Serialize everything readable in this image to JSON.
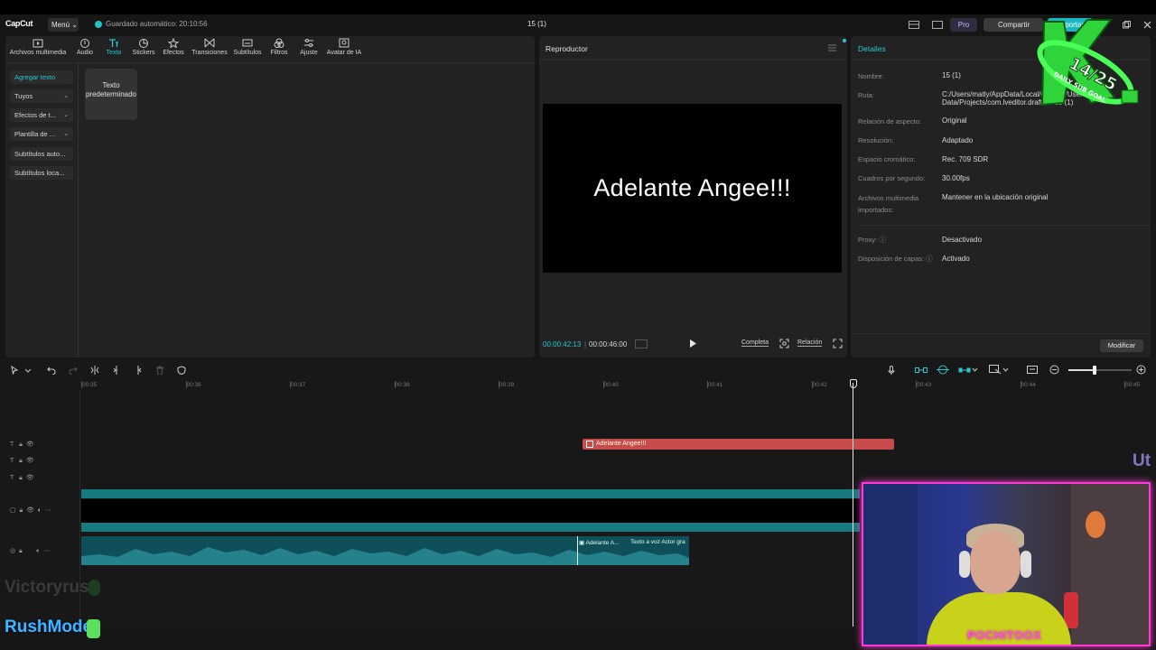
{
  "app": {
    "logo": "CapCut",
    "menu_label": "Menú",
    "autosave": "Guardado automático: 20:10:56",
    "project_title": "15 (1)",
    "pro_label": "Pro",
    "share_label": "Compartir",
    "export_label": "Exportar"
  },
  "toolbar": {
    "items": [
      {
        "label": "Archivos multimedia",
        "icon": "media-icon"
      },
      {
        "label": "Audio",
        "icon": "audio-icon"
      },
      {
        "label": "Texto",
        "icon": "text-icon"
      },
      {
        "label": "Stickers",
        "icon": "sticker-icon"
      },
      {
        "label": "Efectos",
        "icon": "effects-icon"
      },
      {
        "label": "Transiciones",
        "icon": "transitions-icon"
      },
      {
        "label": "Subtítulos",
        "icon": "subtitles-icon"
      },
      {
        "label": "Filtros",
        "icon": "filters-icon"
      },
      {
        "label": "Ajuste",
        "icon": "adjust-icon"
      },
      {
        "label": "Avatar de IA",
        "icon": "ai-avatar-icon"
      }
    ],
    "active": "Texto"
  },
  "sidebar": {
    "items": [
      {
        "label": "Agregar texto"
      },
      {
        "label": "Tuyos"
      },
      {
        "label": "Efectos de t..."
      },
      {
        "label": "Plantilla de ..."
      },
      {
        "label": "Subtítulos auto..."
      },
      {
        "label": "Subtítulos loca..."
      }
    ]
  },
  "text_card": {
    "label": "Texto predeterminado"
  },
  "player": {
    "title": "Reproductor",
    "video_text": "Adelante Angee!!!",
    "current_time": "00:00:42:13",
    "total_time": "00:00:46:00",
    "complete_label": "Completa",
    "ratio_label": "Relación"
  },
  "details": {
    "title": "Detalles",
    "fields": [
      {
        "label": "Nombre:",
        "value": "15 (1)"
      },
      {
        "label": "Ruta:",
        "value": "C:/Users/matly/AppData/Local/CapCut/User Data/Projects/com.lveditor.draft/10/15 (1)"
      },
      {
        "label": "Relación de aspecto:",
        "value": "Original"
      },
      {
        "label": "Resolución:",
        "value": "Adaptado"
      },
      {
        "label": "Espacio cromático:",
        "value": "Rec. 709 SDR"
      },
      {
        "label": "Cuadros por segundo:",
        "value": "30.00fps"
      },
      {
        "label": "Archivos multimedia importados:",
        "value": "Mantener en la ubicación original"
      },
      {
        "label": "Proxy:",
        "value": "Desactivado"
      },
      {
        "label": "Disposición de capas:",
        "value": "Activado"
      }
    ],
    "modify_label": "Modificar"
  },
  "timeline": {
    "ruler": [
      "00:35",
      "00:36",
      "00:37",
      "00:38",
      "00:39",
      "00:40",
      "00:41",
      "00:42",
      "00:43",
      "00:44",
      "00:45"
    ],
    "text_clip": "Adelante Angee!!!",
    "audio_clips": [
      "Adelante A...",
      "Texto a voz Actor gra"
    ]
  },
  "overlay": {
    "chat_user_1": "Victoryrust:",
    "chat_user_2": "RushMode:",
    "cam_name": "POCHITOOX",
    "goal_count": "14/25",
    "goal_label": "DAILY SUB GOAL",
    "side_text": "Ut"
  }
}
